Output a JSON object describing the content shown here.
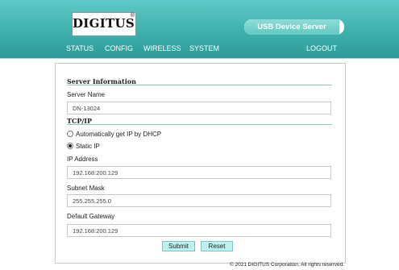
{
  "header": {
    "logo_text": "DIGITUS",
    "logo_mark": "®",
    "product_name": "USB Device Server",
    "nav": {
      "status": "STATUS",
      "config": "CONFIG",
      "wireless": "WIRELESS",
      "system": "SYSTEM",
      "logout": "LOGOUT"
    }
  },
  "server_info": {
    "title": "Server Information",
    "server_name_label": "Server Name",
    "server_name_value": "DN-13024"
  },
  "tcpip": {
    "title": "TCP/IP",
    "dhcp_label": "Automatically get IP by DHCP",
    "static_label": "Static IP",
    "selected_mode": "static",
    "ip_label": "IP Address",
    "ip_value": "192.168.200.129",
    "mask_label": "Subnet Mask",
    "mask_value": "255.255.255.0",
    "gateway_label": "Default Gateway",
    "gateway_value": "192.168.200.129"
  },
  "buttons": {
    "submit": "Submit",
    "reset": "Reset"
  },
  "footer": {
    "copyright": "© 2021 DIGITUS Corporation. All rights reserved."
  },
  "colors": {
    "header_teal": "#3fb0ad",
    "button_fill": "#bdf0ef",
    "section_rule": "#8ec4c2"
  }
}
